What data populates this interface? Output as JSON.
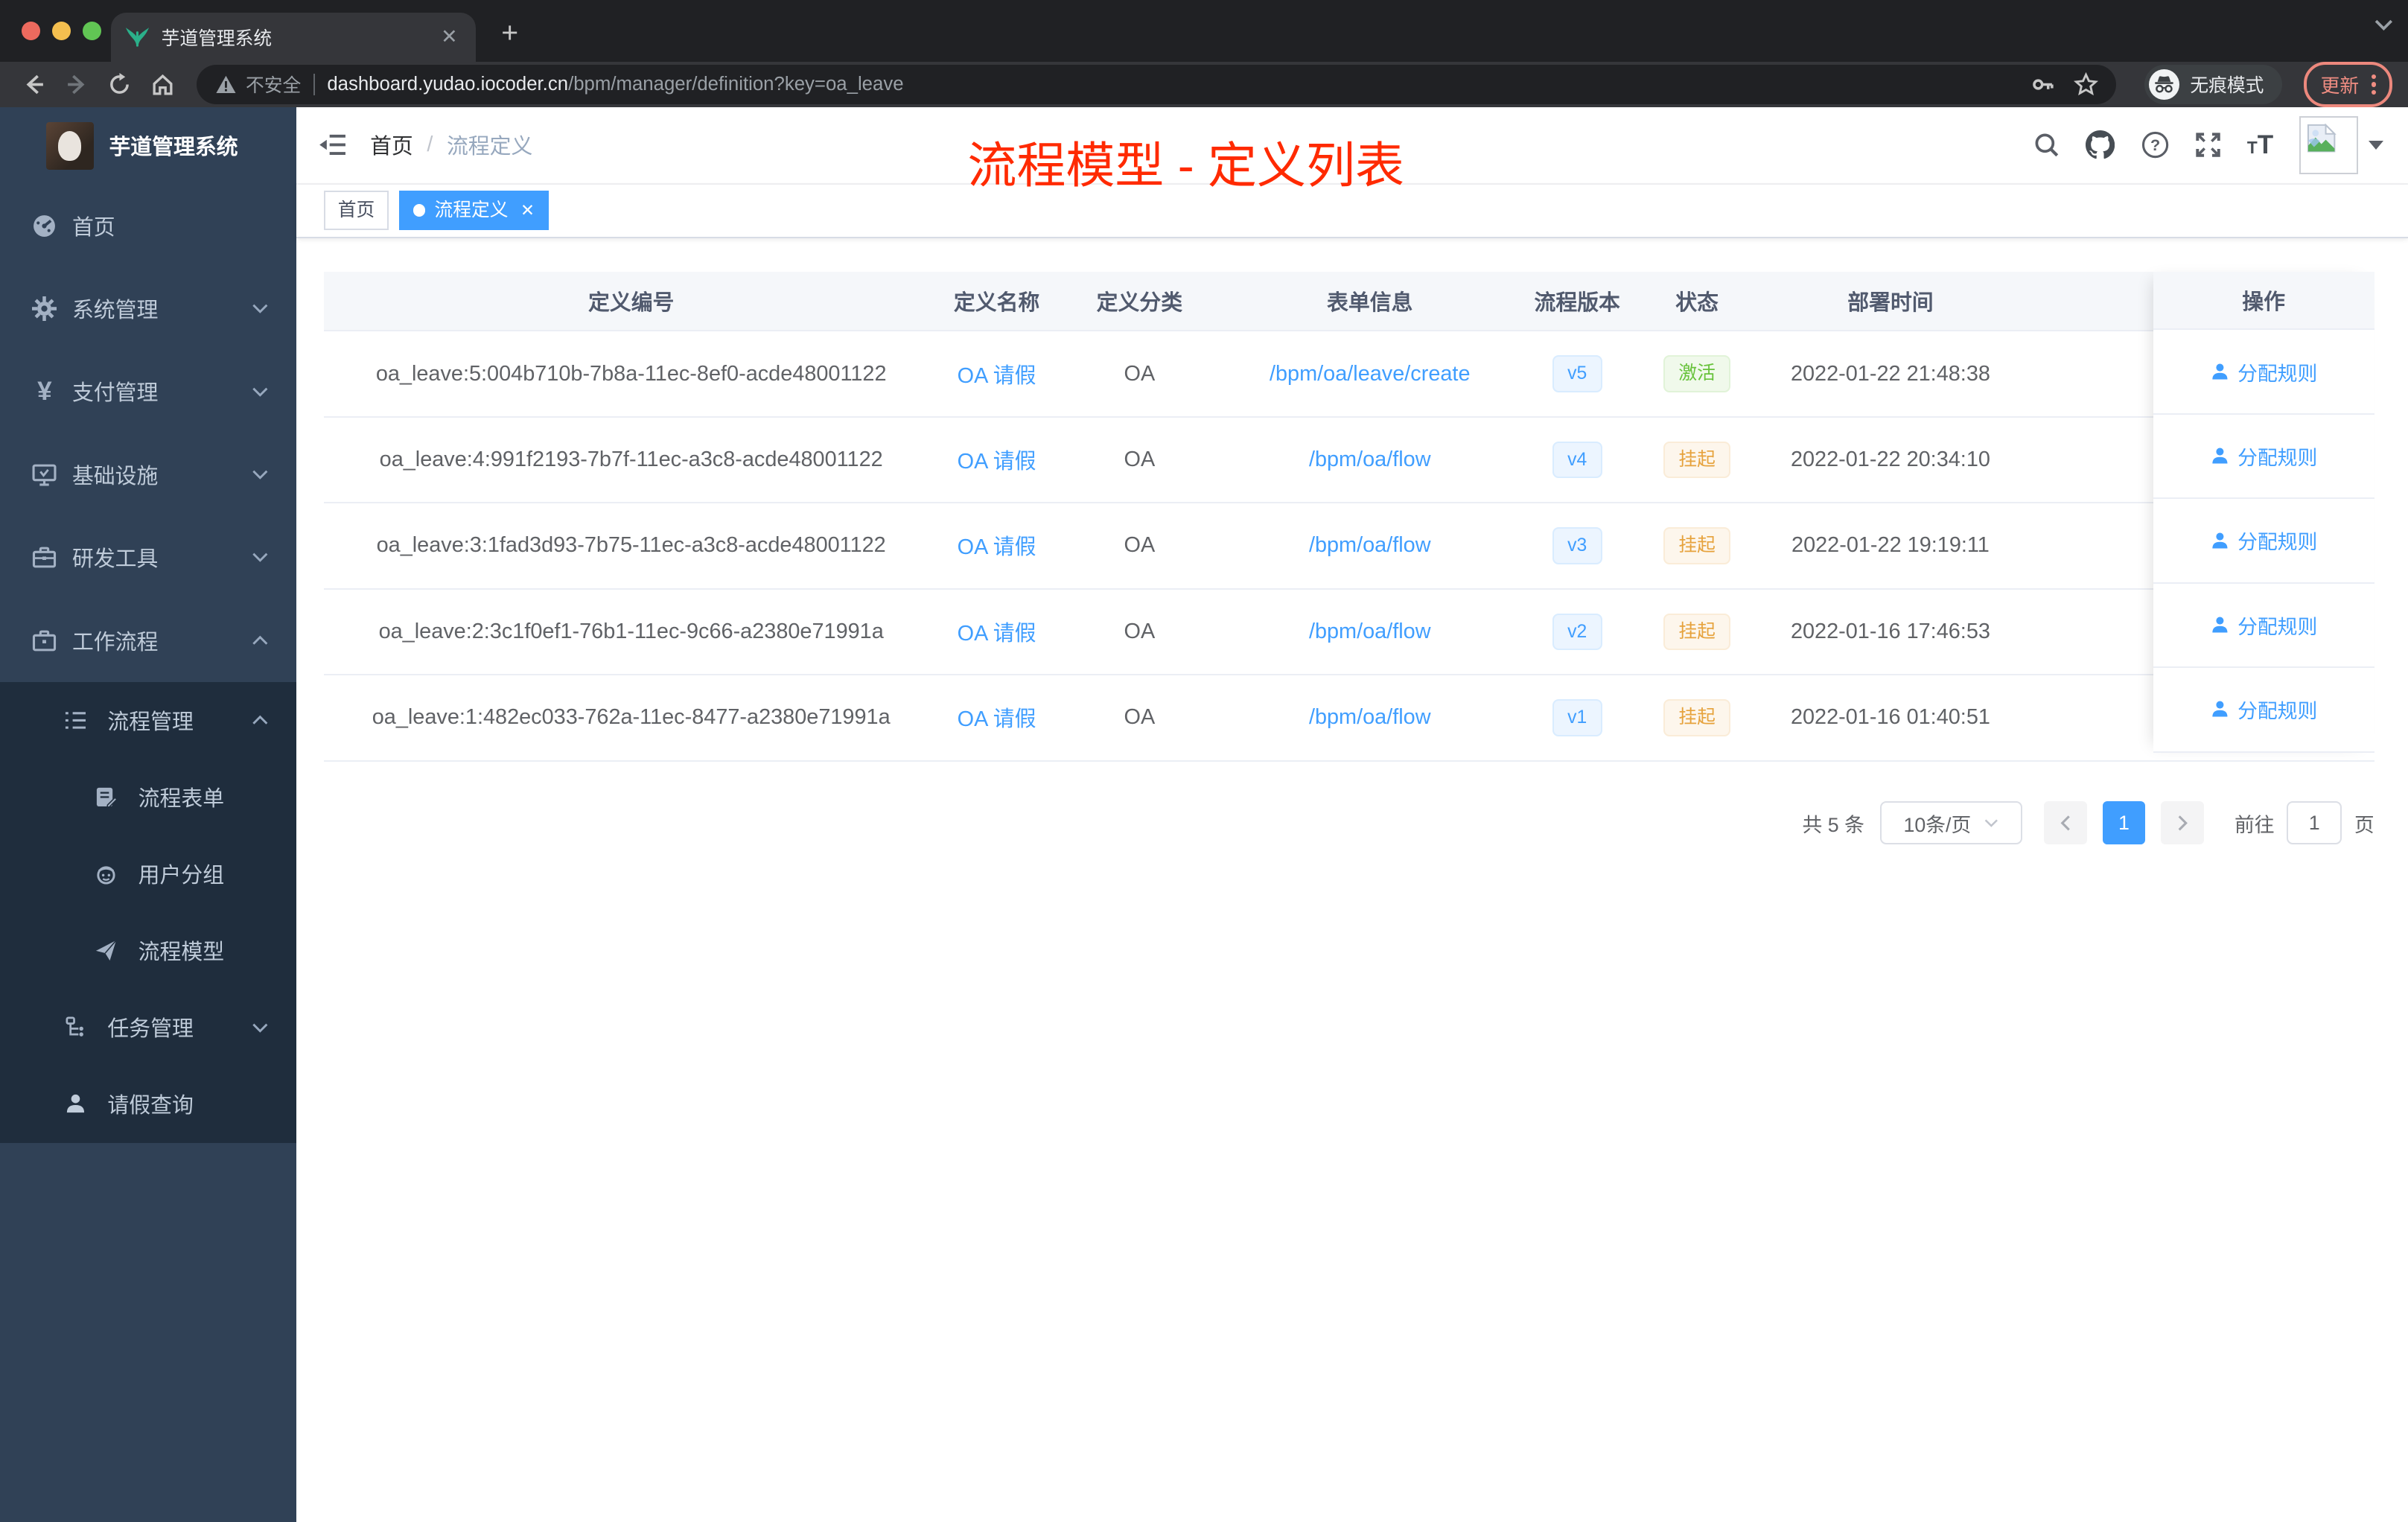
{
  "colors": {
    "accent": "#409eff",
    "success": "#67c23a",
    "warning": "#e6a23c",
    "annotation_red": "#ff2a00",
    "sidebar_bg": "#304156",
    "submenu_bg": "#1f2d3d"
  },
  "browser": {
    "tab_title": "芋道管理系统",
    "security_label": "不安全",
    "url_host": "dashboard.yudao.iocoder.cn",
    "url_path": "/bpm/manager/definition?key=oa_leave",
    "incognito_label": "无痕模式",
    "update_label": "更新"
  },
  "sidebar": {
    "app_title": "芋道管理系统",
    "items": [
      {
        "label": "首页"
      },
      {
        "label": "系统管理"
      },
      {
        "label": "支付管理"
      },
      {
        "label": "基础设施"
      },
      {
        "label": "研发工具"
      },
      {
        "label": "工作流程"
      }
    ],
    "submenu": [
      {
        "label": "流程管理"
      },
      {
        "label": "流程表单"
      },
      {
        "label": "用户分组"
      },
      {
        "label": "流程模型"
      },
      {
        "label": "任务管理"
      },
      {
        "label": "请假查询"
      }
    ]
  },
  "header": {
    "breadcrumb": [
      "首页",
      "流程定义"
    ],
    "annotation": "流程模型 - 定义列表"
  },
  "tags": [
    {
      "label": "首页"
    },
    {
      "label": "流程定义"
    }
  ],
  "table": {
    "headers": [
      "定义编号",
      "定义名称",
      "定义分类",
      "表单信息",
      "流程版本",
      "状态",
      "部署时间",
      "操作"
    ],
    "rows": [
      {
        "id": "oa_leave:5:004b710b-7b8a-11ec-8ef0-acde48001122",
        "name": "OA 请假",
        "category": "OA",
        "form": "/bpm/oa/leave/create",
        "version": "v5",
        "status": "激活",
        "time": "2022-01-22 21:48:38",
        "action": "分配规则"
      },
      {
        "id": "oa_leave:4:991f2193-7b7f-11ec-a3c8-acde48001122",
        "name": "OA 请假",
        "category": "OA",
        "form": "/bpm/oa/flow",
        "version": "v4",
        "status": "挂起",
        "time": "2022-01-22 20:34:10",
        "action": "分配规则"
      },
      {
        "id": "oa_leave:3:1fad3d93-7b75-11ec-a3c8-acde48001122",
        "name": "OA 请假",
        "category": "OA",
        "form": "/bpm/oa/flow",
        "version": "v3",
        "status": "挂起",
        "time": "2022-01-22 19:19:11",
        "action": "分配规则"
      },
      {
        "id": "oa_leave:2:3c1f0ef1-76b1-11ec-9c66-a2380e71991a",
        "name": "OA 请假",
        "category": "OA",
        "form": "/bpm/oa/flow",
        "version": "v2",
        "status": "挂起",
        "time": "2022-01-16 17:46:53",
        "action": "分配规则"
      },
      {
        "id": "oa_leave:1:482ec033-762a-11ec-8477-a2380e71991a",
        "name": "OA 请假",
        "category": "OA",
        "form": "/bpm/oa/flow",
        "version": "v1",
        "status": "挂起",
        "time": "2022-01-16 01:40:51",
        "action": "分配规则"
      }
    ]
  },
  "pagination": {
    "total": "共 5 条",
    "page_size": "10条/页",
    "current": "1",
    "goto_label": "前往",
    "goto_value": "1",
    "unit": "页"
  }
}
